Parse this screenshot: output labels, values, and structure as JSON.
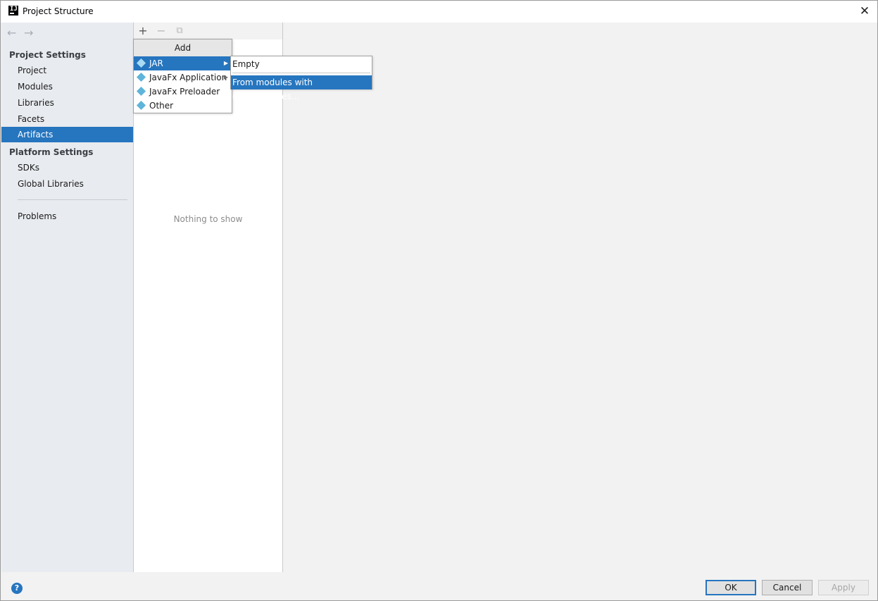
{
  "window": {
    "title": "Project Structure",
    "close_glyph": "✕",
    "app_icon_text": "IJ"
  },
  "nav": {
    "back_glyph": "←",
    "forward_glyph": "→",
    "project_settings_header": "Project Settings",
    "project_items": [
      {
        "label": "Project"
      },
      {
        "label": "Modules"
      },
      {
        "label": "Libraries"
      },
      {
        "label": "Facets"
      },
      {
        "label": "Artifacts"
      }
    ],
    "platform_settings_header": "Platform Settings",
    "platform_items": [
      {
        "label": "SDKs"
      },
      {
        "label": "Global Libraries"
      }
    ],
    "problems_label": "Problems",
    "selected": "Artifacts"
  },
  "toolbar": {
    "add_glyph": "+",
    "remove_glyph": "−",
    "copy_glyph": "⧉"
  },
  "middle": {
    "empty_text": "Nothing to show"
  },
  "add_popup": {
    "header": "Add",
    "items": [
      {
        "label": "JAR",
        "has_submenu": true
      },
      {
        "label": "JavaFx Application",
        "has_submenu": true
      },
      {
        "label": "JavaFx Preloader",
        "has_submenu": false
      },
      {
        "label": "Other",
        "has_submenu": false
      }
    ],
    "selected": "JAR",
    "submenu_glyph": "▶"
  },
  "jar_submenu": {
    "items": [
      {
        "label": "Empty"
      },
      {
        "label": "From modules with dependencies..."
      }
    ],
    "selected": "From modules with dependencies..."
  },
  "footer": {
    "help_glyph": "?",
    "ok_label": "OK",
    "cancel_label": "Cancel",
    "apply_label": "Apply"
  },
  "colors": {
    "accent": "#2675bf",
    "sidebar_bg": "#e8ebef",
    "window_bg": "#f2f2f2"
  }
}
